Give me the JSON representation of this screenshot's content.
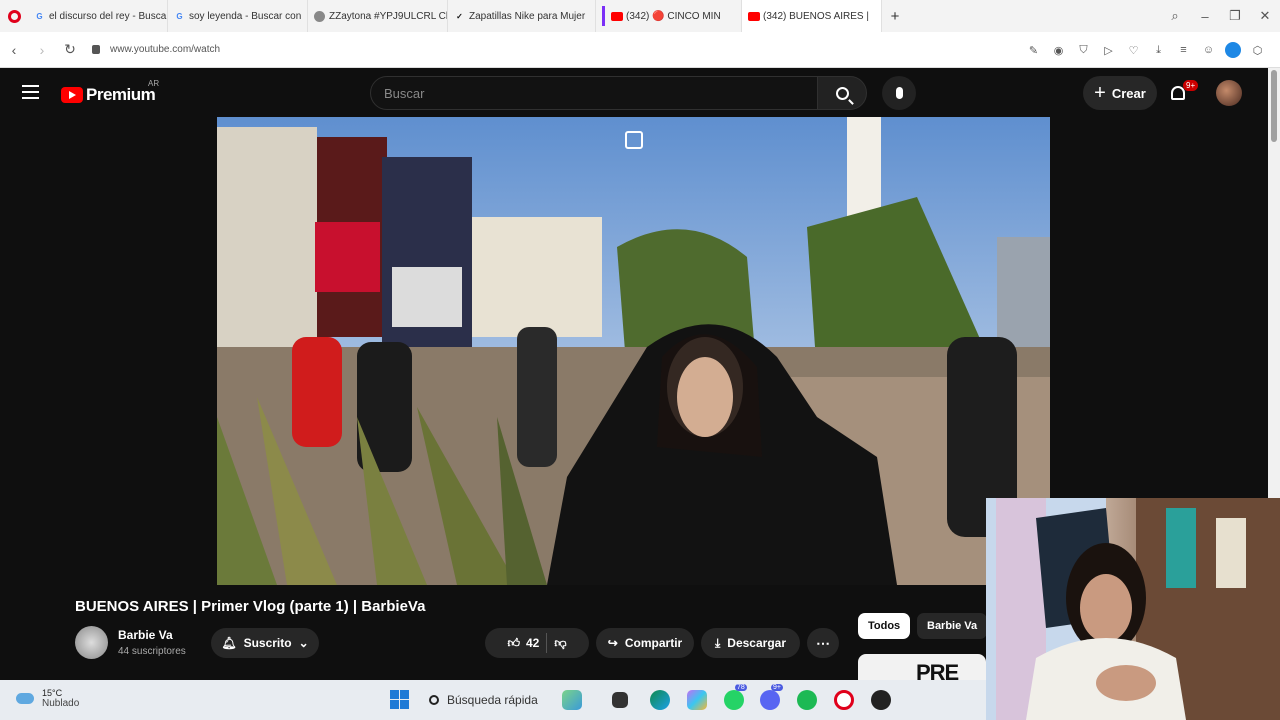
{
  "browser": {
    "tabs": [
      {
        "label": "el discurso del rey - Busca",
        "favicon": "google-icon"
      },
      {
        "label": "soy leyenda - Buscar con",
        "favicon": "google-icon"
      },
      {
        "label": "ZZaytona #YPJ9ULCRL Cla",
        "favicon": "game-icon"
      },
      {
        "label": "Zapatillas Nike para Mujer",
        "favicon": "nike-icon"
      },
      {
        "label": "(342) 🔴 CINCO MIN",
        "favicon": "youtube-icon"
      },
      {
        "label": "(342) BUENOS AIRES |",
        "favicon": "youtube-icon",
        "active": true
      }
    ],
    "url": "www.youtube.com/watch"
  },
  "youtube": {
    "logo_text": "Premium",
    "country_code": "AR",
    "search_placeholder": "Buscar",
    "create_label": "Crear",
    "notifications_badge": "9+"
  },
  "video": {
    "title": "BUENOS AIRES | Primer Vlog (parte 1) | BarbieVa",
    "channel_name": "Barbie Va",
    "channel_subs": "44 suscriptores",
    "subscribe_label": "Suscrito",
    "likes": "42",
    "share_label": "Compartir",
    "download_label": "Descargar"
  },
  "sidebar_chips": {
    "chip_all": "Todos",
    "chip_channel": "Barbie Va",
    "thumb_text": "PRE"
  },
  "taskbar": {
    "weather_temp": "15°C",
    "weather_desc": "Nublado",
    "search_label": "Búsqueda rápida",
    "whatsapp_badge": "78",
    "discord_badge": "9+"
  },
  "colors": {
    "yt_red": "#ff0000",
    "bg": "#0f0f0f",
    "pill_bg": "#272727"
  }
}
